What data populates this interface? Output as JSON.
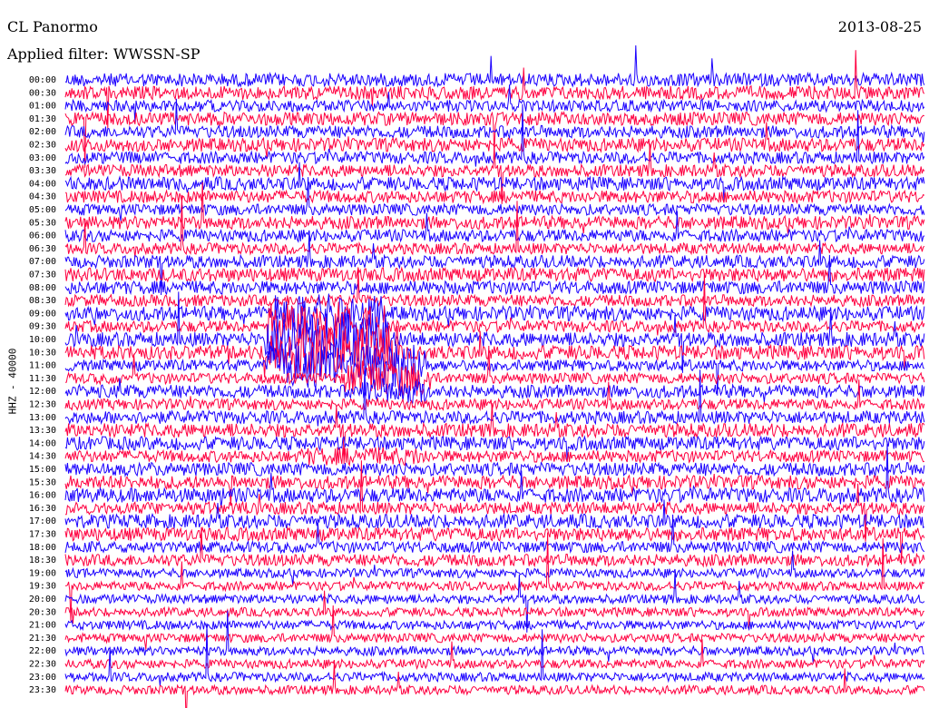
{
  "header": {
    "station": "CL Panormo",
    "filter": "Applied filter: WWSSN-SP",
    "date": "2013-08-25"
  },
  "chart_data": {
    "type": "line",
    "title": "CL Panormo",
    "ylabel": "HHZ - 40000",
    "categories": [
      "00:00",
      "00:30",
      "01:00",
      "01:30",
      "02:00",
      "02:30",
      "03:00",
      "03:30",
      "04:00",
      "04:30",
      "05:00",
      "05:30",
      "06:00",
      "06:30",
      "07:00",
      "07:30",
      "08:00",
      "08:30",
      "09:00",
      "09:30",
      "10:00",
      "10:30",
      "11:00",
      "11:30",
      "12:00",
      "12:30",
      "13:00",
      "13:30",
      "14:00",
      "14:30",
      "15:00",
      "15:30",
      "16:00",
      "16:30",
      "17:00",
      "17:30",
      "18:00",
      "18:30",
      "19:00",
      "19:30",
      "20:00",
      "20:30",
      "21:00",
      "21:30",
      "22:00",
      "22:30",
      "23:00",
      "23:30"
    ],
    "series_colors": [
      "#1a00ff",
      "#ff0040"
    ],
    "grid": false
  }
}
